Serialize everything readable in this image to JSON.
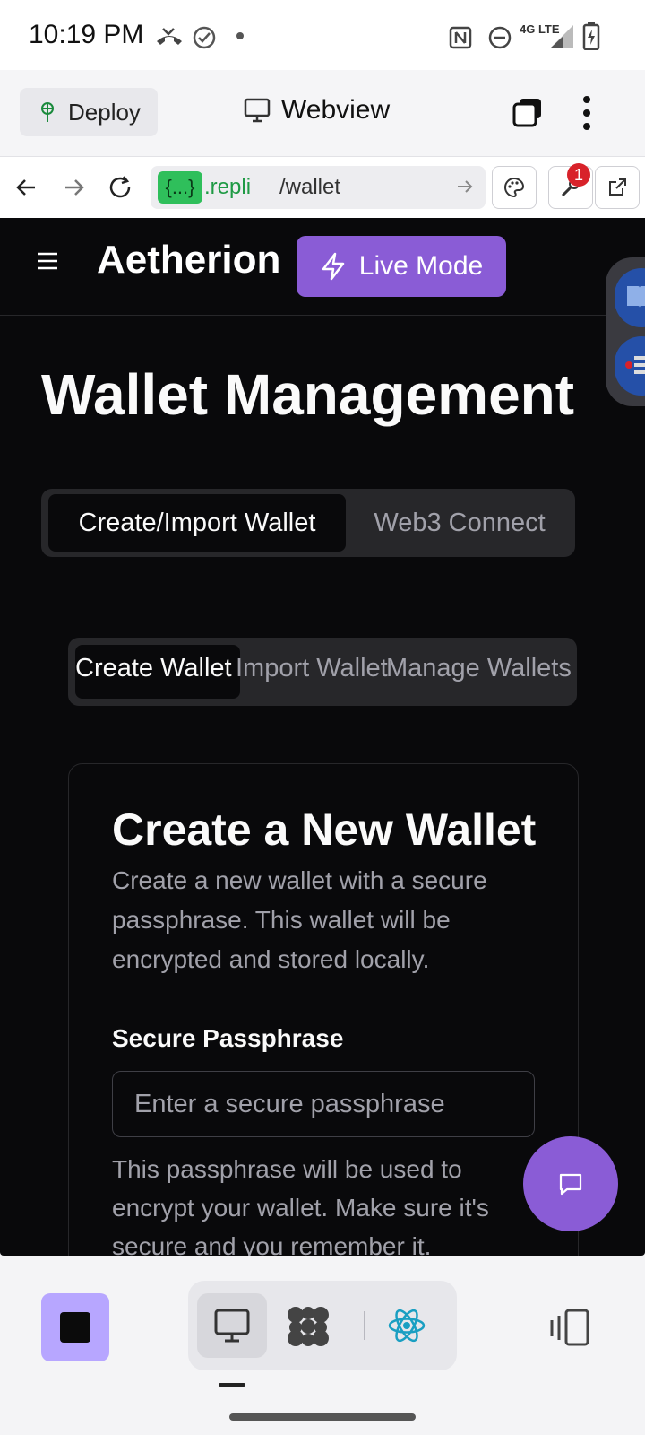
{
  "status_bar": {
    "time": "10:19 PM",
    "network": "4G LTE",
    "icons": [
      "missed-call-icon",
      "check-circle-icon",
      "dot-icon",
      "nfc-icon",
      "do-not-disturb-icon",
      "signal-icon",
      "battery-icon"
    ]
  },
  "webview_header": {
    "deploy_label": "Deploy",
    "title": "Webview"
  },
  "address_bar": {
    "badge": "{...}",
    "host": ".repli",
    "path": "/wallet",
    "notification_count": "1"
  },
  "app": {
    "brand": "Aetherion",
    "live_mode_label": "Live Mode",
    "page_title": "Wallet Management",
    "tabs": [
      {
        "label": "Create/Import Wallet",
        "active": true
      },
      {
        "label": "Web3 Connect",
        "active": false
      }
    ],
    "subtabs": [
      {
        "label": "Create Wallet",
        "active": true
      },
      {
        "label": "Import Wallet",
        "active": false
      },
      {
        "label": "Manage Wallets",
        "active": false
      }
    ],
    "card": {
      "title": "Create a New Wallet",
      "description": "Create a new wallet with a secure passphrase. This wallet will be encrypted and stored locally.",
      "passphrase_label": "Secure Passphrase",
      "passphrase_placeholder": "Enter a secure passphrase",
      "passphrase_value": "",
      "passphrase_help": "This passphrase will be used to encrypt your wallet. Make sure it's secure and you remember it."
    }
  },
  "colors": {
    "accent": "#8a5cd6",
    "app_background": "#09090b",
    "muted_text": "#a1a1aa",
    "stop_button": "#b7a6ff",
    "url_badge": "#2fbf5b"
  }
}
